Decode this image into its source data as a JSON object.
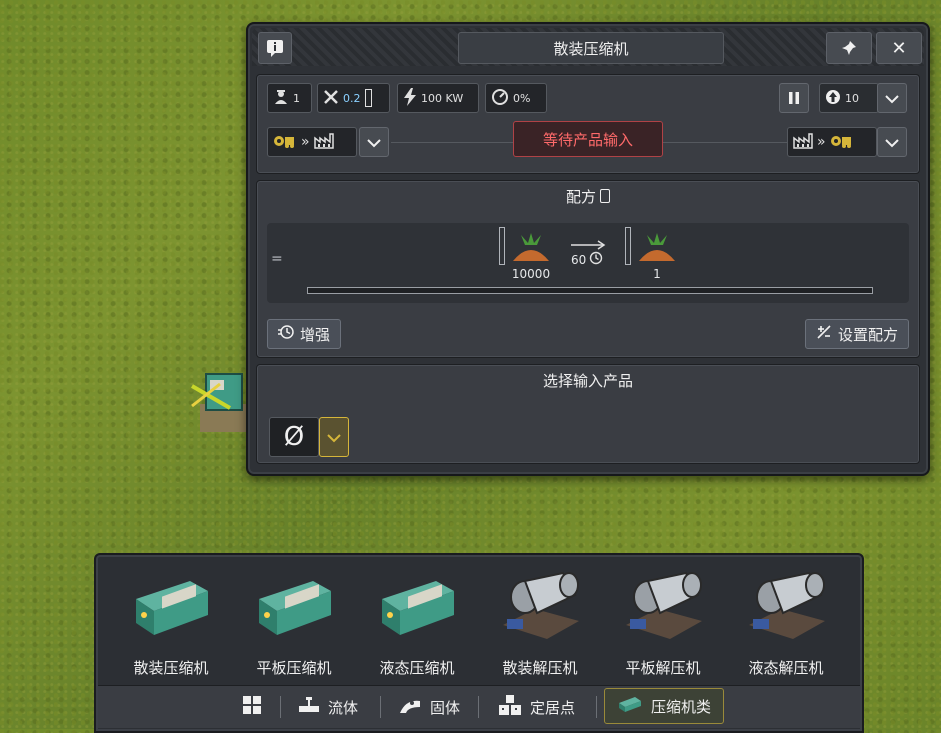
{
  "panel": {
    "title": "散装压缩机",
    "info_icon": "info-icon",
    "pin_icon": "pin-icon",
    "close_icon": "close-icon",
    "stats": {
      "workers": "1",
      "maintenance": "0.2",
      "power": "100 KW",
      "utilization": "0%"
    },
    "priority": "10",
    "status_text": "等待产品输入",
    "recipe": {
      "title": "配方",
      "input_quantity": "10000",
      "duration": "60",
      "output_quantity": "1",
      "boost_label": "增强",
      "set_recipe_label": "设置配方"
    },
    "input_select": {
      "title": "选择输入产品",
      "value": "Ø"
    }
  },
  "toolbar": {
    "tools": [
      {
        "label": "散装压缩机",
        "kind": "compressor"
      },
      {
        "label": "平板压缩机",
        "kind": "compressor"
      },
      {
        "label": "液态压缩机",
        "kind": "compressor"
      },
      {
        "label": "散装解压机",
        "kind": "decompressor"
      },
      {
        "label": "平板解压机",
        "kind": "decompressor"
      },
      {
        "label": "液态解压机",
        "kind": "decompressor"
      }
    ],
    "tabs": {
      "fluid": "流体",
      "solid": "固体",
      "settlement": "定居点",
      "compression": "压缩机类"
    }
  },
  "colors": {
    "status_red": "#ff6a6a",
    "accent_yellow": "#d6b63a",
    "machine_teal": "#3f9b86"
  }
}
